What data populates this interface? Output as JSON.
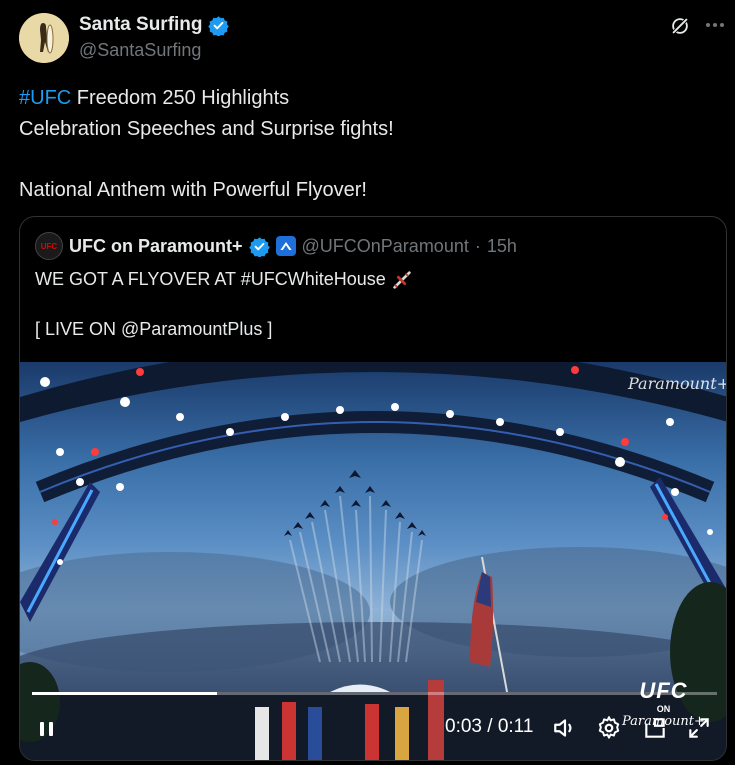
{
  "author": {
    "display_name": "Santa Surfing",
    "handle": "@SantaSurfing"
  },
  "tweet": {
    "hashtag": "#UFC",
    "line1_rest": " Freedom 250 Highlights",
    "line2": "Celebration Speeches and Surprise fights!",
    "line4": "National Anthem with Powerful Flyover!"
  },
  "quoted": {
    "display_name": "UFC on Paramount+",
    "avatar_text": "UFC",
    "handle": "@UFCOnParamount",
    "separator": "·",
    "time_ago": "15h",
    "text_line1": "WE GOT A FLYOVER AT #UFCWhiteHouse",
    "text_line3": "[ LIVE ON @ParamountPlus ]"
  },
  "video": {
    "watermark": "Paramount+",
    "logo_big": "UFC",
    "logo_on": "ON",
    "logo_pp": "Paramount+",
    "current_time": "0:03",
    "total_time": "0:11",
    "time_display": "0:03 / 0:11",
    "progress_fraction": 0.27
  },
  "icons": {
    "verified": "verified-badge-icon",
    "grok": "grok-icon",
    "more": "more-icon",
    "pause": "pause-icon",
    "volume": "volume-icon",
    "settings": "settings-gear-icon",
    "pip": "picture-in-picture-icon",
    "fullscreen": "fullscreen-icon"
  },
  "colors": {
    "accent": "#1d9bf0",
    "background": "#000000",
    "text": "#e7e9ea",
    "muted": "#71767b"
  }
}
